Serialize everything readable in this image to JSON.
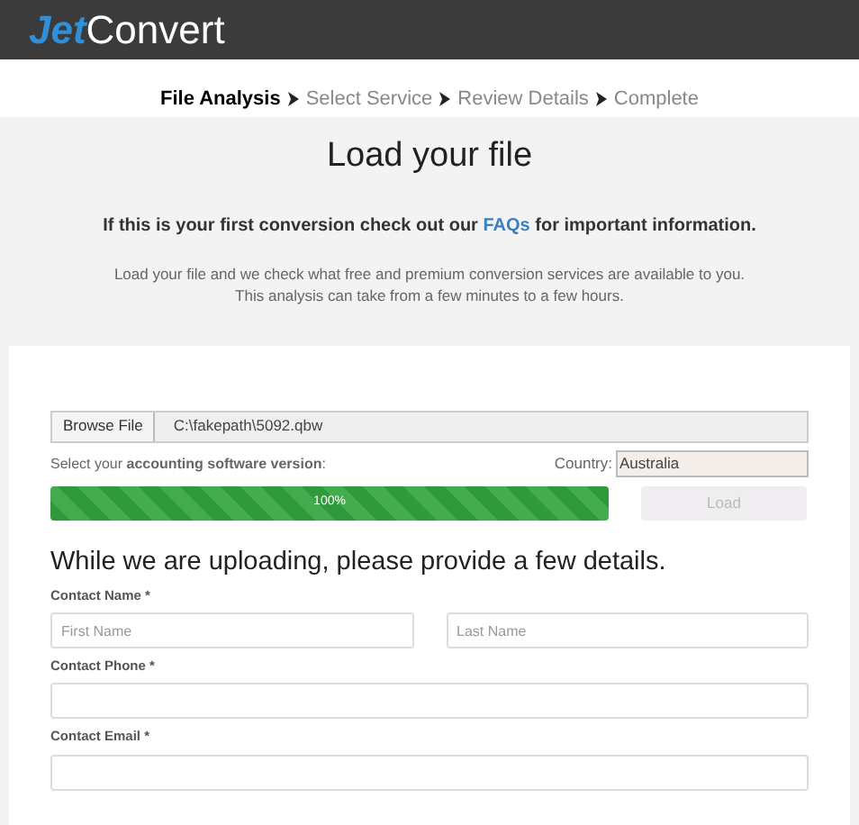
{
  "header": {
    "logo_accent": "Jet",
    "logo_rest": "Convert"
  },
  "steps": [
    {
      "label": "File Analysis",
      "selected": true
    },
    {
      "label": "Select Service",
      "selected": false
    },
    {
      "label": "Review Details",
      "selected": false
    },
    {
      "label": "Complete",
      "selected": false
    }
  ],
  "title": "Load your file",
  "notice": {
    "before": "If this is your first conversion check out our",
    "link": "FAQs",
    "after": "for important information."
  },
  "intro": [
    "Load your file and we check what free and premium conversion services are available to you.",
    "This analysis can take from a few minutes to a few hours."
  ],
  "upload": {
    "browse_button": "Browse File",
    "file_path": "C:\\fakepath\\5092.qbw",
    "version_prompt": "Select your **accounting software version**:",
    "country_label": "Country:",
    "country_value": "Australia",
    "progress": {
      "level": 1,
      "reading": "100%"
    },
    "load_button": {
      "label": "Load",
      "disabled": true
    }
  },
  "details": {
    "heading": "While we are uploading, please provide a few details.",
    "fields": [
      {
        "label": "Contact Name *",
        "kind": "split",
        "inputs": [
          {
            "placeholder": "First Name"
          },
          {
            "placeholder": "Last Name"
          }
        ]
      },
      {
        "label": "Contact Phone *",
        "kind": "single"
      },
      {
        "label": "Contact Email *",
        "kind": "single"
      }
    ]
  }
}
